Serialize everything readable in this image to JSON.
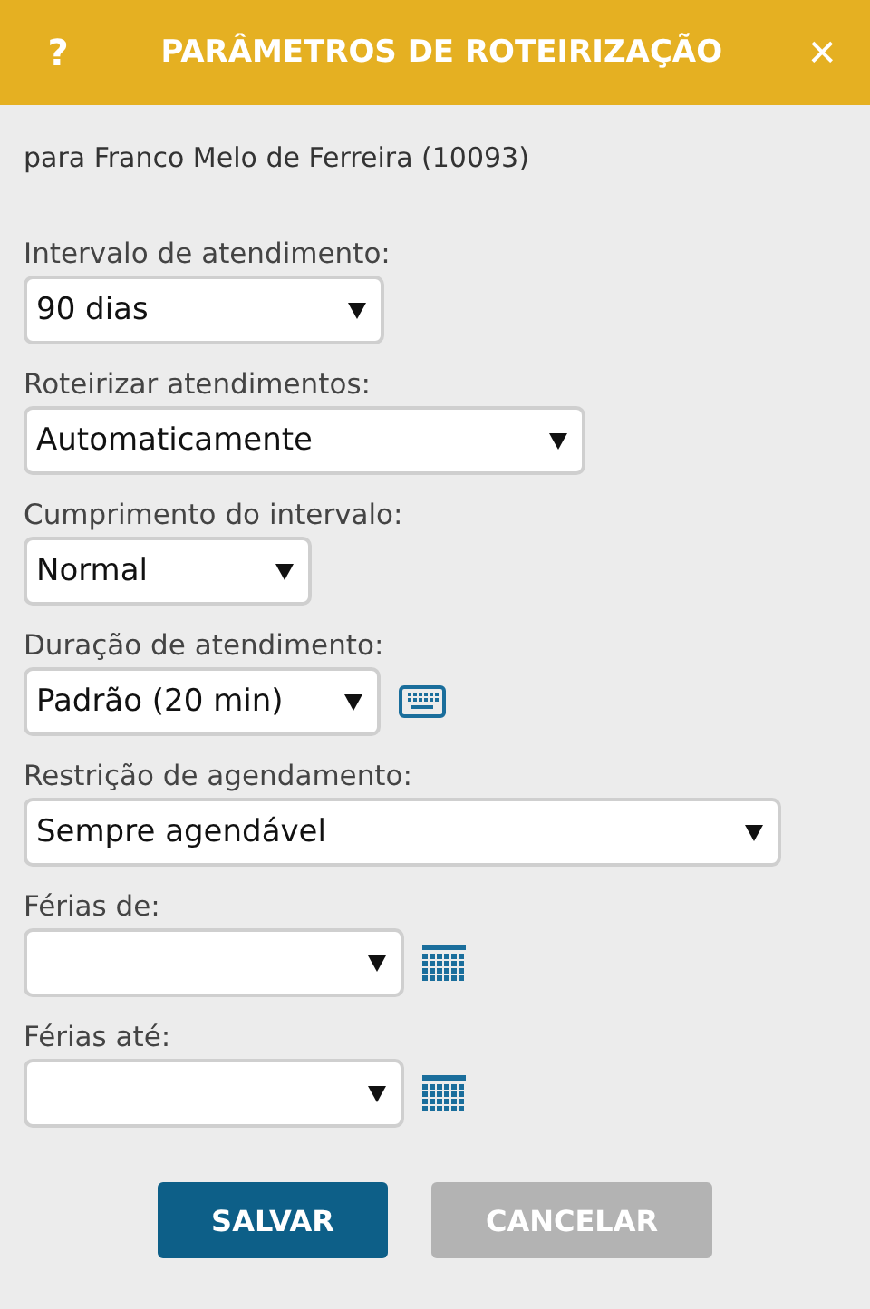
{
  "header": {
    "help": "?",
    "title": "PARÂMETROS DE ROTEIRIZAÇÃO",
    "close": "✕"
  },
  "subtitle": "para Franco Melo de Ferreira (10093)",
  "fields": [
    {
      "label": "Intervalo de atendimento:",
      "value": "90 dias"
    },
    {
      "label": "Roteirizar atendimentos:",
      "value": "Automaticamente"
    },
    {
      "label": "Cumprimento do intervalo:",
      "value": "Normal"
    },
    {
      "label": "Duração de atendimento:",
      "value": "Padrão (20 min)",
      "kind": "keyboard"
    },
    {
      "label": "Restrição de agendamento:",
      "value": "Sempre agendável"
    },
    {
      "label": "Férias de:",
      "kind": "calendar"
    },
    {
      "label": "Férias até:",
      "kind": "calendar"
    }
  ],
  "buttons": [
    {
      "label": "SALVAR",
      "kind": "primary"
    },
    {
      "label": "CANCELAR",
      "kind": "secondary"
    }
  ]
}
